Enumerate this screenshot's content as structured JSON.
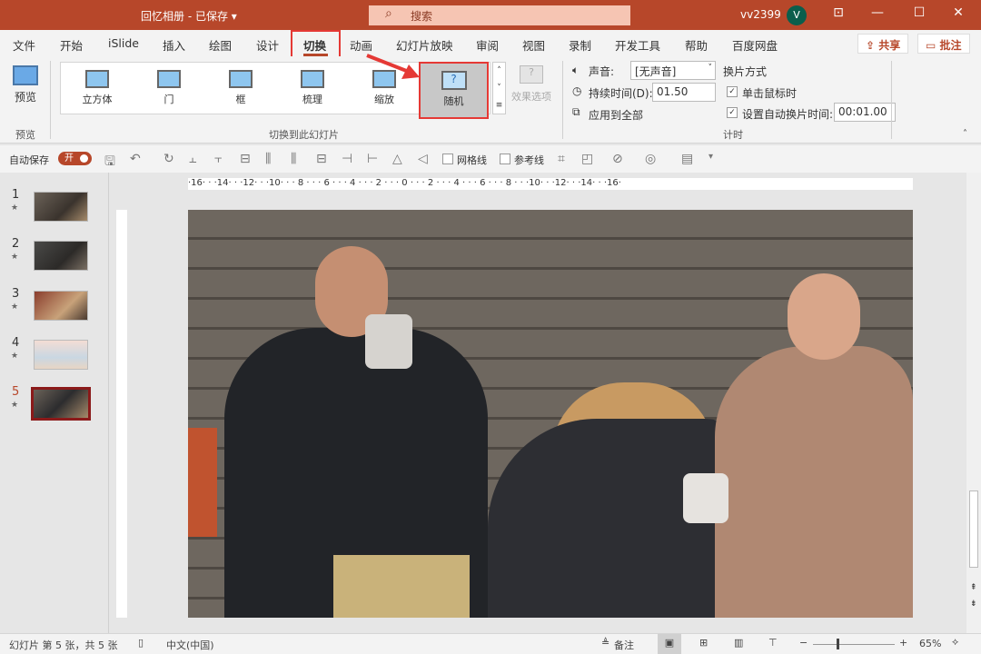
{
  "titlebar": {
    "title": "回忆相册 - 已保存 ▾",
    "search_placeholder": "搜索",
    "user": "vv2399",
    "avatar_initial": "V"
  },
  "menu": {
    "tabs": [
      "文件",
      "开始",
      "iSlide",
      "插入",
      "绘图",
      "设计",
      "切换",
      "动画",
      "幻灯片放映",
      "审阅",
      "视图",
      "录制",
      "开发工具",
      "帮助",
      "百度网盘"
    ],
    "active": "切换",
    "share": "共享",
    "comment": "批注"
  },
  "ribbon": {
    "preview": {
      "button": "预览",
      "group": "预览"
    },
    "transitions": [
      "立方体",
      "门",
      "框",
      "梳理",
      "缩放",
      "随机"
    ],
    "selected": "随机",
    "effect_options": "效果选项",
    "group_transition": "切换到此幻灯片",
    "sound_label": "声音:",
    "sound_value": "[无声音]",
    "duration_label": "持续时间(D):",
    "duration_value": "01.50",
    "apply_all": "应用到全部",
    "advance_title": "换片方式",
    "on_click": "单击鼠标时",
    "on_click_checked": true,
    "auto_label": "设置自动换片时间:",
    "auto_checked": true,
    "auto_value": "00:01.00",
    "group_timing": "计时"
  },
  "qat": {
    "autosave": "自动保存",
    "toggle": "开",
    "gridlines": "网格线",
    "guides": "参考线"
  },
  "ruler": "·16· · ·14· · ·12· · ·10· · · 8 · · · 6 · · · 4 · · · 2 · · · 0 · · · 2 · · · 4 · · · 6 · · · 8 · · ·10· · ·12· · ·14· · ·16·",
  "slides": [
    {
      "n": "1"
    },
    {
      "n": "2"
    },
    {
      "n": "3"
    },
    {
      "n": "4"
    },
    {
      "n": "5",
      "active": true
    }
  ],
  "status": {
    "slide_info": "幻灯片 第 5 张，共 5 张",
    "language": "中文(中国)",
    "notes": "备注",
    "zoom": "65%"
  },
  "colors": {
    "accent": "#b7472a",
    "highlight": "#e53935"
  }
}
